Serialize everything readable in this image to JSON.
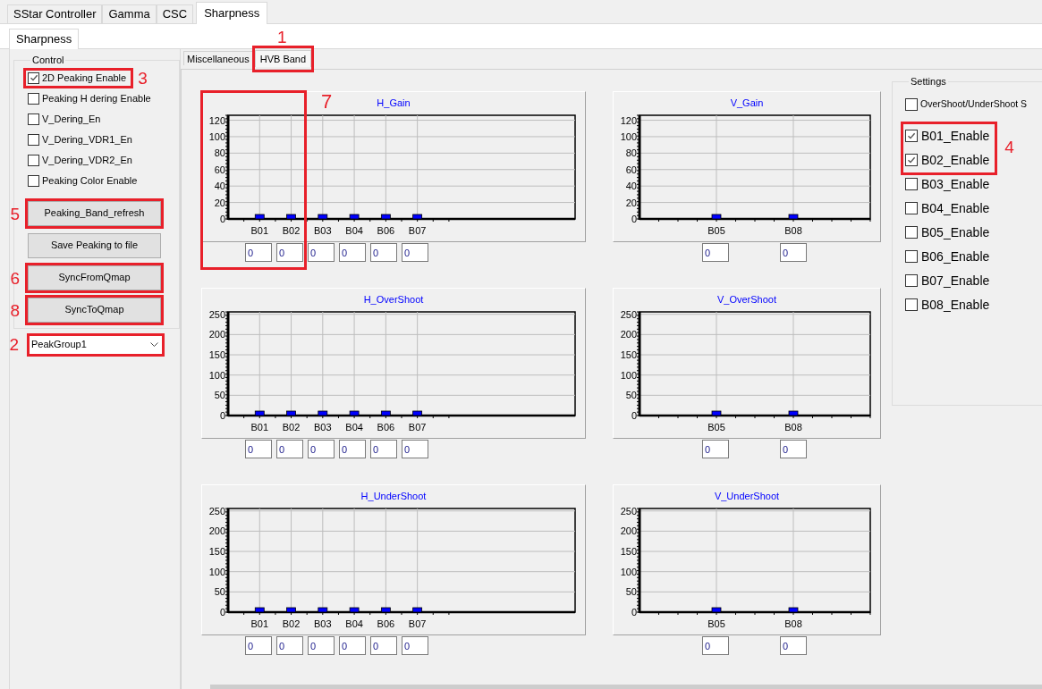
{
  "main_tabs": [
    {
      "label": "SStar Controller",
      "selected": false
    },
    {
      "label": "Gamma",
      "selected": false
    },
    {
      "label": "CSC",
      "selected": false
    },
    {
      "label": "Sharpness",
      "selected": true
    }
  ],
  "sub_tabs": [
    {
      "label": "Sharpness",
      "selected": true
    }
  ],
  "control": {
    "title": "Control",
    "checkboxes": [
      {
        "label": "2D Peaking Enable",
        "checked": true,
        "callout": "3"
      },
      {
        "label": "Peaking H dering Enable",
        "checked": false
      },
      {
        "label": "V_Dering_En",
        "checked": false
      },
      {
        "label": "V_Dering_VDR1_En",
        "checked": false
      },
      {
        "label": "V_Dering_VDR2_En",
        "checked": false
      },
      {
        "label": "Peaking Color Enable",
        "checked": false
      }
    ],
    "buttons": [
      {
        "label": "Peaking_Band_refresh",
        "callout": "5"
      },
      {
        "label": "Save Peaking to file"
      },
      {
        "label": "SyncFromQmap",
        "callout": "6"
      },
      {
        "label": "SyncToQmap",
        "callout": "8"
      }
    ],
    "dropdown": {
      "value": "PeakGroup1",
      "callout": "2"
    }
  },
  "band_tabs": [
    {
      "label": "Miscellaneous",
      "selected": false
    },
    {
      "label": "HVB Band",
      "selected": true,
      "callout": "1"
    }
  ],
  "charts": [
    {
      "kind": "h",
      "title": "H_Gain",
      "callout": "7",
      "inputs": [
        "0",
        "0",
        "0",
        "0",
        "0",
        "0"
      ],
      "chart_data": {
        "type": "bar",
        "categories": [
          "B01",
          "B02",
          "B03",
          "B04",
          "B06",
          "B07"
        ],
        "values": [
          0,
          0,
          0,
          0,
          0,
          0
        ],
        "ylim": [
          0,
          126
        ],
        "yticks": [
          0,
          20,
          40,
          60,
          80,
          100,
          120
        ],
        "grid": true
      }
    },
    {
      "kind": "v",
      "title": "V_Gain",
      "inputs": [
        "0",
        "0"
      ],
      "chart_data": {
        "type": "bar",
        "categories": [
          "B05",
          "B08"
        ],
        "values": [
          0,
          0
        ],
        "ylim": [
          0,
          126
        ],
        "yticks": [
          0,
          20,
          40,
          60,
          80,
          100,
          120
        ],
        "grid": true
      }
    },
    {
      "kind": "h",
      "title": "H_OverShoot",
      "inputs": [
        "0",
        "0",
        "0",
        "0",
        "0",
        "0"
      ],
      "chart_data": {
        "type": "bar",
        "categories": [
          "B01",
          "B02",
          "B03",
          "B04",
          "B06",
          "B07"
        ],
        "values": [
          0,
          0,
          0,
          0,
          0,
          0
        ],
        "ylim": [
          0,
          256
        ],
        "yticks": [
          0,
          50,
          100,
          150,
          200,
          250
        ],
        "grid": true
      }
    },
    {
      "kind": "v",
      "title": "V_OverShoot",
      "inputs": [
        "0",
        "0"
      ],
      "chart_data": {
        "type": "bar",
        "categories": [
          "B05",
          "B08"
        ],
        "values": [
          0,
          0
        ],
        "ylim": [
          0,
          256
        ],
        "yticks": [
          0,
          50,
          100,
          150,
          200,
          250
        ],
        "grid": true
      }
    },
    {
      "kind": "h",
      "title": "H_UnderShoot",
      "inputs": [
        "0",
        "0",
        "0",
        "0",
        "0",
        "0"
      ],
      "chart_data": {
        "type": "bar",
        "categories": [
          "B01",
          "B02",
          "B03",
          "B04",
          "B06",
          "B07"
        ],
        "values": [
          0,
          0,
          0,
          0,
          0,
          0
        ],
        "ylim": [
          0,
          256
        ],
        "yticks": [
          0,
          50,
          100,
          150,
          200,
          250
        ],
        "grid": true
      }
    },
    {
      "kind": "v",
      "title": "V_UnderShoot",
      "inputs": [
        "0",
        "0"
      ],
      "chart_data": {
        "type": "bar",
        "categories": [
          "B05",
          "B08"
        ],
        "values": [
          0,
          0
        ],
        "ylim": [
          0,
          256
        ],
        "yticks": [
          0,
          50,
          100,
          150,
          200,
          250
        ],
        "grid": true
      }
    }
  ],
  "settings": {
    "title": "Settings",
    "callout": "4",
    "header_checkbox": {
      "label": "OverShoot/UnderShoot S",
      "checked": false
    },
    "checkboxes": [
      {
        "label": "B01_Enable",
        "checked": true,
        "highlighted": true
      },
      {
        "label": "B02_Enable",
        "checked": true,
        "highlighted": true
      },
      {
        "label": "B03_Enable",
        "checked": false,
        "highlighted": false
      },
      {
        "label": "B04_Enable",
        "checked": false,
        "highlighted": false
      },
      {
        "label": "B05_Enable",
        "checked": false,
        "highlighted": false
      },
      {
        "label": "B06_Enable",
        "checked": false,
        "highlighted": false
      },
      {
        "label": "B07_Enable",
        "checked": false,
        "highlighted": false
      },
      {
        "label": "B08_Enable",
        "checked": false,
        "highlighted": false
      }
    ]
  }
}
